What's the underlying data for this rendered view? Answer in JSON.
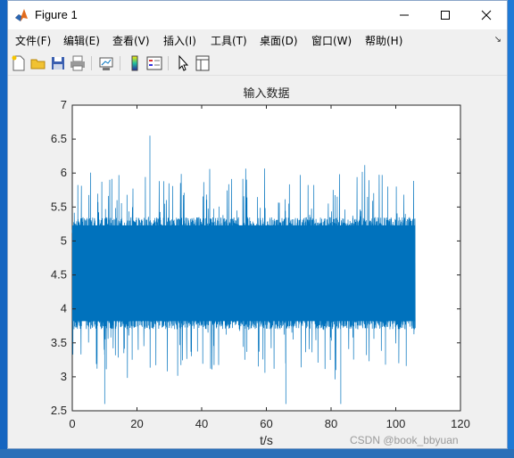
{
  "window": {
    "title": "Figure 1",
    "minimize_glyph": "—",
    "close_glyph": "✕"
  },
  "menu": [
    {
      "label": "文件(F)"
    },
    {
      "label": "编辑(E)"
    },
    {
      "label": "查看(V)"
    },
    {
      "label": "插入(I)"
    },
    {
      "label": "工具(T)"
    },
    {
      "label": "桌面(D)"
    },
    {
      "label": "窗口(W)"
    },
    {
      "label": "帮助(H)"
    }
  ],
  "menu_pin": "↘",
  "toolbar_icons": [
    "new-figure-icon",
    "open-file-icon",
    "save-icon",
    "print-icon",
    "link-plot-icon",
    "insert-colorbar-icon",
    "insert-legend-icon",
    "edit-plot-pointer-icon",
    "open-property-inspector-icon"
  ],
  "colors": {
    "line": "#0072bd",
    "accent": "#0072bd"
  },
  "chart_data": {
    "type": "line",
    "title": "输入数据",
    "xlabel": "t/s",
    "ylabel": "",
    "xlim": [
      0,
      120
    ],
    "ylim": [
      2.5,
      7
    ],
    "xticks": [
      0,
      20,
      40,
      60,
      80,
      100,
      120
    ],
    "yticks": [
      2.5,
      3,
      3.5,
      4,
      4.5,
      5,
      5.5,
      6,
      6.5,
      7
    ],
    "grid": false,
    "series": [
      {
        "x_range": [
          0,
          106
        ],
        "mean": 4.5,
        "band": [
          3.7,
          5.35
        ],
        "min": 2.6,
        "max": 6.55,
        "description_points": [
          [
            24,
            6.55
          ],
          [
            10,
            2.6
          ],
          [
            66,
            2.6
          ],
          [
            83,
            2.6
          ]
        ]
      }
    ]
  },
  "watermark": "CSDN @book_bbyuan"
}
